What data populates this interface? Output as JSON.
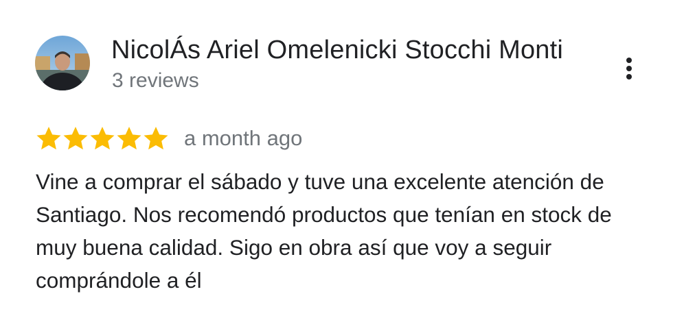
{
  "reviewer": {
    "name": "NicolÁs Ariel Omelenicki Stocchi Monti",
    "review_count": "3 reviews"
  },
  "review": {
    "rating": 5,
    "max_rating": 5,
    "date": "a month ago",
    "text": "Vine a comprar el sábado y tuve una excelente atención de Santiago. Nos recomendó productos que tenían en stock de muy buena calidad. Sigo en obra así que voy a seguir comprándole a él"
  },
  "icons": {
    "more": "more-vert-icon",
    "star": "star-icon"
  },
  "colors": {
    "star": "#fbbc04",
    "secondary_text": "#70757a",
    "primary_text": "#202124"
  }
}
